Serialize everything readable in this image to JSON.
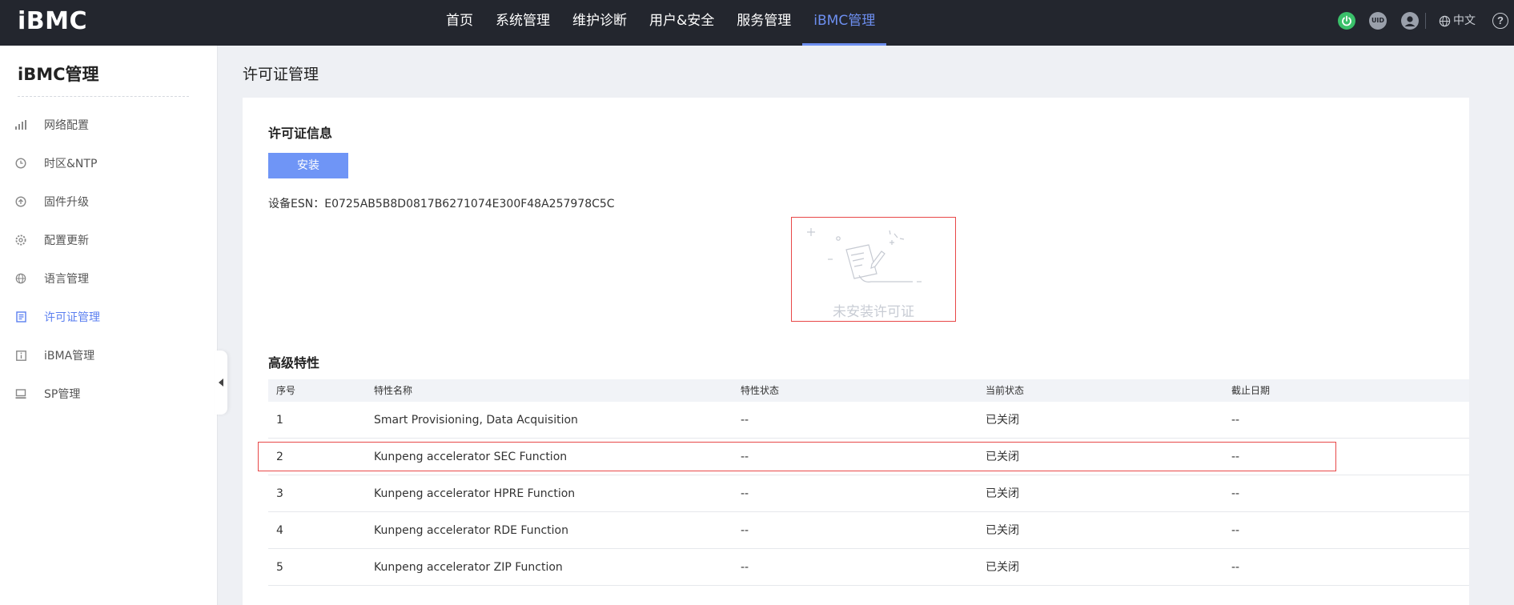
{
  "app": {
    "logo": "iBMC"
  },
  "nav": [
    {
      "label": "首页",
      "active": false
    },
    {
      "label": "系统管理",
      "active": false
    },
    {
      "label": "维护诊断",
      "active": false
    },
    {
      "label": "用户&安全",
      "active": false
    },
    {
      "label": "服务管理",
      "active": false
    },
    {
      "label": "iBMC管理",
      "active": true
    }
  ],
  "tools": {
    "uid": "UID",
    "lang": "中文",
    "help": "?"
  },
  "sidebar": {
    "title": "iBMC管理",
    "items": [
      {
        "label": "网络配置",
        "icon": "bar-chart-icon",
        "active": false
      },
      {
        "label": "时区&NTP",
        "icon": "clock-icon",
        "active": false
      },
      {
        "label": "固件升级",
        "icon": "upload-icon",
        "active": false
      },
      {
        "label": "配置更新",
        "icon": "gear-icon",
        "active": false
      },
      {
        "label": "语言管理",
        "icon": "globe-icon",
        "active": false
      },
      {
        "label": "许可证管理",
        "icon": "document-icon",
        "active": true
      },
      {
        "label": "iBMA管理",
        "icon": "info-icon",
        "active": false
      },
      {
        "label": "SP管理",
        "icon": "monitor-icon",
        "active": false
      }
    ]
  },
  "main": {
    "page_title": "许可证管理",
    "license_info": {
      "title": "许可证信息",
      "install_label": "安装",
      "esn_label": "设备ESN：",
      "esn_value": "E0725AB5B8D0817B6271074E300F48A257978C5C",
      "empty_text": "未安装许可证"
    },
    "features": {
      "title": "高级特性",
      "columns": [
        "序号",
        "特性名称",
        "特性状态",
        "当前状态",
        "截止日期"
      ],
      "rows": [
        [
          "1",
          "Smart Provisioning, Data Acquisition",
          "--",
          "已关闭",
          "--"
        ],
        [
          "2",
          "Kunpeng accelerator SEC Function",
          "--",
          "已关闭",
          "--"
        ],
        [
          "3",
          "Kunpeng accelerator HPRE Function",
          "--",
          "已关闭",
          "--"
        ],
        [
          "4",
          "Kunpeng accelerator RDE Function",
          "--",
          "已关闭",
          "--"
        ],
        [
          "5",
          "Kunpeng accelerator ZIP Function",
          "--",
          "已关闭",
          "--"
        ]
      ]
    }
  },
  "colors": {
    "accent": "#6d8ff0",
    "topbar": "#23262e",
    "highlight": "#e84848",
    "power": "#3ac06a"
  }
}
